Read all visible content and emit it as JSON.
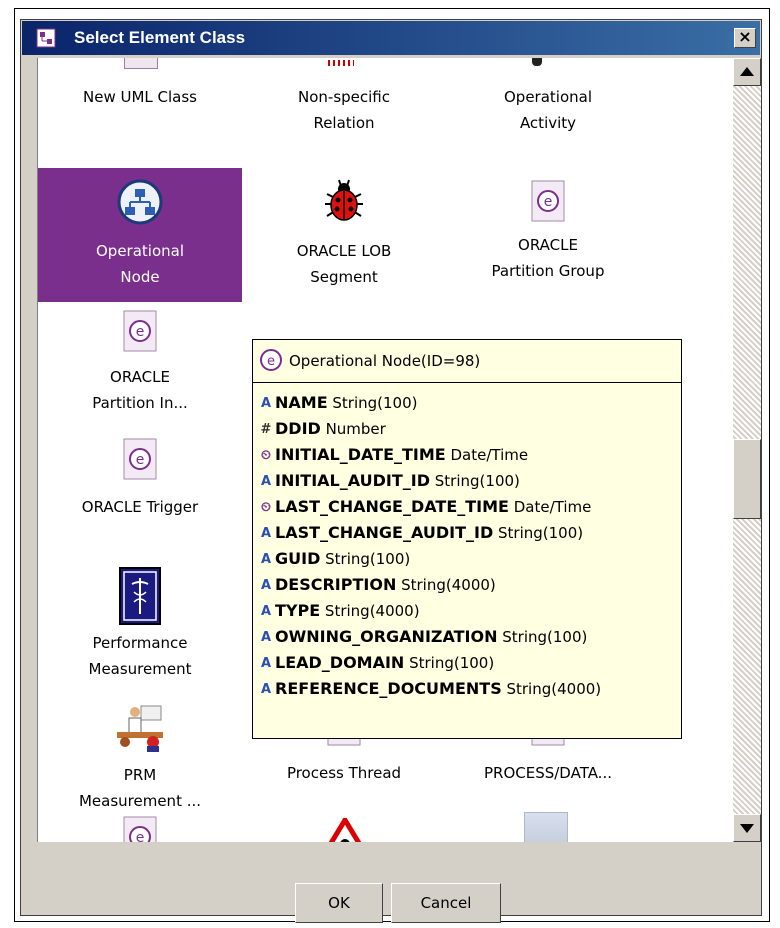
{
  "window": {
    "title": "Select Element Class",
    "close_label": "×"
  },
  "items": [
    {
      "line1": "New UML Class",
      "line2": "",
      "icon": "uml-class-icon"
    },
    {
      "line1": "Non-specific",
      "line2": "Relation",
      "icon": "relation-icon"
    },
    {
      "line1": "Operational",
      "line2": "Activity",
      "icon": "activity-icon"
    },
    {
      "line1": "Operational",
      "line2": "Node",
      "icon": "network-node-icon",
      "selected": true
    },
    {
      "line1": "ORACLE LOB",
      "line2": "Segment",
      "icon": "ladybug-icon"
    },
    {
      "line1": "ORACLE",
      "line2": "Partition Group",
      "icon": "entity-icon"
    },
    {
      "line1": "ORACLE",
      "line2": "Partition In...",
      "icon": "entity-icon"
    },
    {
      "line1": "ORACLE Trigger",
      "line2": "",
      "icon": "entity-icon"
    },
    {
      "line1": "Performance",
      "line2": "Measurement",
      "icon": "caduceus-icon"
    },
    {
      "line1": "PRM",
      "line2": "Measurement ...",
      "icon": "presenter-icon"
    },
    {
      "line1": "Process Thread",
      "line2": "",
      "icon": "entity-icon"
    },
    {
      "line1": "PROCESS/DATA...",
      "line2": "",
      "icon": "entity-icon"
    }
  ],
  "tooltip": {
    "header": "Operational Node(ID=98)",
    "attributes": [
      {
        "name": "NAME",
        "type": "String(100)",
        "kind": "string"
      },
      {
        "name": "DDID",
        "type": "Number",
        "kind": "number"
      },
      {
        "name": "INITIAL_DATE_TIME",
        "type": "Date/Time",
        "kind": "datetime"
      },
      {
        "name": "INITIAL_AUDIT_ID",
        "type": "String(100)",
        "kind": "string"
      },
      {
        "name": "LAST_CHANGE_DATE_TIME",
        "type": "Date/Time",
        "kind": "datetime"
      },
      {
        "name": "LAST_CHANGE_AUDIT_ID",
        "type": "String(100)",
        "kind": "string"
      },
      {
        "name": "GUID",
        "type": "String(100)",
        "kind": "string"
      },
      {
        "name": "DESCRIPTION",
        "type": "String(4000)",
        "kind": "string"
      },
      {
        "name": "TYPE",
        "type": "String(4000)",
        "kind": "string"
      },
      {
        "name": "OWNING_ORGANIZATION",
        "type": "String(100)",
        "kind": "string"
      },
      {
        "name": "LEAD_DOMAIN",
        "type": "String(100)",
        "kind": "string"
      },
      {
        "name": "REFERENCE_DOCUMENTS",
        "type": "String(4000)",
        "kind": "string"
      }
    ]
  },
  "buttons": {
    "ok": "OK",
    "cancel": "Cancel"
  },
  "colors": {
    "selection": "#7b2f8c",
    "tooltip_bg": "#ffffe1",
    "title_start": "#0a246a",
    "title_end": "#3a6ea5"
  }
}
